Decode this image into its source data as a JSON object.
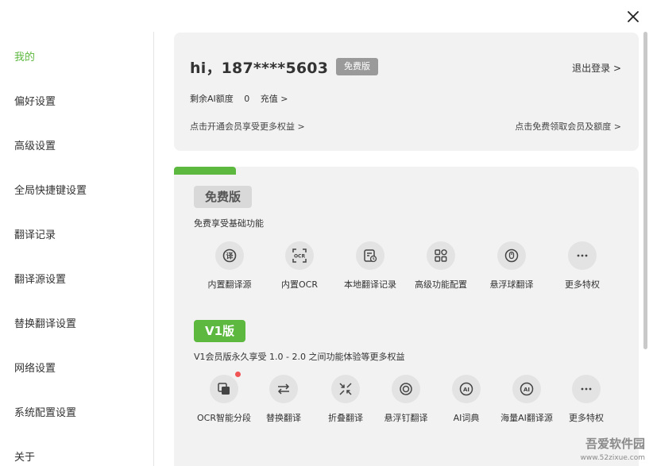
{
  "sidebar": {
    "items": [
      {
        "label": "我的",
        "active": true
      },
      {
        "label": "偏好设置"
      },
      {
        "label": "高级设置"
      },
      {
        "label": "全局快捷键设置"
      },
      {
        "label": "翻译记录"
      },
      {
        "label": "翻译源设置"
      },
      {
        "label": "替换翻译设置"
      },
      {
        "label": "网络设置"
      },
      {
        "label": "系统配置设置"
      },
      {
        "label": "关于"
      }
    ]
  },
  "user": {
    "greeting": "hi，187****5603",
    "badge": "免费版",
    "logout": "退出登录 >",
    "quota_label": "剩余AI额度",
    "quota_value": "0",
    "recharge": "充值 >",
    "open_vip": "点击开通会员享受更多权益 >",
    "free_vip": "点击免费领取会员及额度 >"
  },
  "tiers": {
    "free": {
      "name": "免费版",
      "desc": "免费享受基础功能",
      "features": [
        {
          "label": "内置翻译源",
          "icon": "translate-icon"
        },
        {
          "label": "内置OCR",
          "icon": "ocr-icon"
        },
        {
          "label": "本地翻译记录",
          "icon": "history-icon"
        },
        {
          "label": "高级功能配置",
          "icon": "apps-icon"
        },
        {
          "label": "悬浮球翻译",
          "icon": "float-ball-icon"
        },
        {
          "label": "更多特权",
          "icon": "more-icon"
        }
      ]
    },
    "v1": {
      "name": "V1版",
      "desc": "V1会员版永久享受 1.0 - 2.0 之间功能体验等更多权益",
      "features": [
        {
          "label": "OCR智能分段",
          "icon": "ocr-segment-icon"
        },
        {
          "label": "替换翻译",
          "icon": "swap-icon"
        },
        {
          "label": "折叠翻译",
          "icon": "collapse-icon"
        },
        {
          "label": "悬浮钉翻译",
          "icon": "pin-icon"
        },
        {
          "label": "AI词典",
          "icon": "ai-icon"
        },
        {
          "label": "海量AI翻译源",
          "icon": "ai-sources-icon"
        },
        {
          "label": "更多特权",
          "icon": "more-icon"
        }
      ]
    }
  },
  "watermark": {
    "text": "吾爱软件园",
    "url": "www.52zixue.com"
  },
  "colors": {
    "accent": "#5cb83e",
    "card": "#f2f2f2",
    "icon_bg": "#e3e3e3",
    "badge_gray": "#9a9a9a",
    "notify": "#f05454"
  }
}
